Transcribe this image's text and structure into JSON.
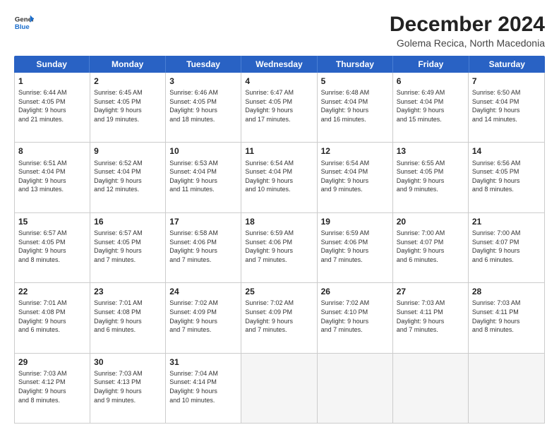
{
  "logo": {
    "line1": "General",
    "line2": "Blue"
  },
  "title": "December 2024",
  "subtitle": "Golema Recica, North Macedonia",
  "weekdays": [
    "Sunday",
    "Monday",
    "Tuesday",
    "Wednesday",
    "Thursday",
    "Friday",
    "Saturday"
  ],
  "weeks": [
    [
      {
        "day": "1",
        "lines": [
          "Sunrise: 6:44 AM",
          "Sunset: 4:05 PM",
          "Daylight: 9 hours",
          "and 21 minutes."
        ]
      },
      {
        "day": "2",
        "lines": [
          "Sunrise: 6:45 AM",
          "Sunset: 4:05 PM",
          "Daylight: 9 hours",
          "and 19 minutes."
        ]
      },
      {
        "day": "3",
        "lines": [
          "Sunrise: 6:46 AM",
          "Sunset: 4:05 PM",
          "Daylight: 9 hours",
          "and 18 minutes."
        ]
      },
      {
        "day": "4",
        "lines": [
          "Sunrise: 6:47 AM",
          "Sunset: 4:05 PM",
          "Daylight: 9 hours",
          "and 17 minutes."
        ]
      },
      {
        "day": "5",
        "lines": [
          "Sunrise: 6:48 AM",
          "Sunset: 4:04 PM",
          "Daylight: 9 hours",
          "and 16 minutes."
        ]
      },
      {
        "day": "6",
        "lines": [
          "Sunrise: 6:49 AM",
          "Sunset: 4:04 PM",
          "Daylight: 9 hours",
          "and 15 minutes."
        ]
      },
      {
        "day": "7",
        "lines": [
          "Sunrise: 6:50 AM",
          "Sunset: 4:04 PM",
          "Daylight: 9 hours",
          "and 14 minutes."
        ]
      }
    ],
    [
      {
        "day": "8",
        "lines": [
          "Sunrise: 6:51 AM",
          "Sunset: 4:04 PM",
          "Daylight: 9 hours",
          "and 13 minutes."
        ]
      },
      {
        "day": "9",
        "lines": [
          "Sunrise: 6:52 AM",
          "Sunset: 4:04 PM",
          "Daylight: 9 hours",
          "and 12 minutes."
        ]
      },
      {
        "day": "10",
        "lines": [
          "Sunrise: 6:53 AM",
          "Sunset: 4:04 PM",
          "Daylight: 9 hours",
          "and 11 minutes."
        ]
      },
      {
        "day": "11",
        "lines": [
          "Sunrise: 6:54 AM",
          "Sunset: 4:04 PM",
          "Daylight: 9 hours",
          "and 10 minutes."
        ]
      },
      {
        "day": "12",
        "lines": [
          "Sunrise: 6:54 AM",
          "Sunset: 4:04 PM",
          "Daylight: 9 hours",
          "and 9 minutes."
        ]
      },
      {
        "day": "13",
        "lines": [
          "Sunrise: 6:55 AM",
          "Sunset: 4:05 PM",
          "Daylight: 9 hours",
          "and 9 minutes."
        ]
      },
      {
        "day": "14",
        "lines": [
          "Sunrise: 6:56 AM",
          "Sunset: 4:05 PM",
          "Daylight: 9 hours",
          "and 8 minutes."
        ]
      }
    ],
    [
      {
        "day": "15",
        "lines": [
          "Sunrise: 6:57 AM",
          "Sunset: 4:05 PM",
          "Daylight: 9 hours",
          "and 8 minutes."
        ]
      },
      {
        "day": "16",
        "lines": [
          "Sunrise: 6:57 AM",
          "Sunset: 4:05 PM",
          "Daylight: 9 hours",
          "and 7 minutes."
        ]
      },
      {
        "day": "17",
        "lines": [
          "Sunrise: 6:58 AM",
          "Sunset: 4:06 PM",
          "Daylight: 9 hours",
          "and 7 minutes."
        ]
      },
      {
        "day": "18",
        "lines": [
          "Sunrise: 6:59 AM",
          "Sunset: 4:06 PM",
          "Daylight: 9 hours",
          "and 7 minutes."
        ]
      },
      {
        "day": "19",
        "lines": [
          "Sunrise: 6:59 AM",
          "Sunset: 4:06 PM",
          "Daylight: 9 hours",
          "and 7 minutes."
        ]
      },
      {
        "day": "20",
        "lines": [
          "Sunrise: 7:00 AM",
          "Sunset: 4:07 PM",
          "Daylight: 9 hours",
          "and 6 minutes."
        ]
      },
      {
        "day": "21",
        "lines": [
          "Sunrise: 7:00 AM",
          "Sunset: 4:07 PM",
          "Daylight: 9 hours",
          "and 6 minutes."
        ]
      }
    ],
    [
      {
        "day": "22",
        "lines": [
          "Sunrise: 7:01 AM",
          "Sunset: 4:08 PM",
          "Daylight: 9 hours",
          "and 6 minutes."
        ]
      },
      {
        "day": "23",
        "lines": [
          "Sunrise: 7:01 AM",
          "Sunset: 4:08 PM",
          "Daylight: 9 hours",
          "and 6 minutes."
        ]
      },
      {
        "day": "24",
        "lines": [
          "Sunrise: 7:02 AM",
          "Sunset: 4:09 PM",
          "Daylight: 9 hours",
          "and 7 minutes."
        ]
      },
      {
        "day": "25",
        "lines": [
          "Sunrise: 7:02 AM",
          "Sunset: 4:09 PM",
          "Daylight: 9 hours",
          "and 7 minutes."
        ]
      },
      {
        "day": "26",
        "lines": [
          "Sunrise: 7:02 AM",
          "Sunset: 4:10 PM",
          "Daylight: 9 hours",
          "and 7 minutes."
        ]
      },
      {
        "day": "27",
        "lines": [
          "Sunrise: 7:03 AM",
          "Sunset: 4:11 PM",
          "Daylight: 9 hours",
          "and 7 minutes."
        ]
      },
      {
        "day": "28",
        "lines": [
          "Sunrise: 7:03 AM",
          "Sunset: 4:11 PM",
          "Daylight: 9 hours",
          "and 8 minutes."
        ]
      }
    ],
    [
      {
        "day": "29",
        "lines": [
          "Sunrise: 7:03 AM",
          "Sunset: 4:12 PM",
          "Daylight: 9 hours",
          "and 8 minutes."
        ]
      },
      {
        "day": "30",
        "lines": [
          "Sunrise: 7:03 AM",
          "Sunset: 4:13 PM",
          "Daylight: 9 hours",
          "and 9 minutes."
        ]
      },
      {
        "day": "31",
        "lines": [
          "Sunrise: 7:04 AM",
          "Sunset: 4:14 PM",
          "Daylight: 9 hours",
          "and 10 minutes."
        ]
      },
      null,
      null,
      null,
      null
    ]
  ]
}
